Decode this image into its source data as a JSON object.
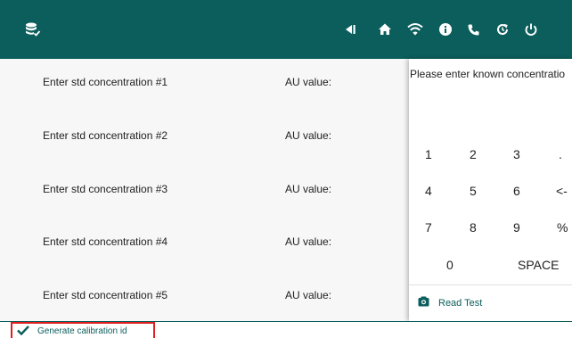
{
  "colors": {
    "header": "#0b5e5c",
    "accent": "#0b5e5c",
    "highlight": "#e02020"
  },
  "header": {
    "icons": [
      "database-check-icon",
      "step-back-icon",
      "home-icon",
      "wifi-icon",
      "info-icon",
      "phone-icon",
      "refresh-icon",
      "power-icon"
    ]
  },
  "rows": [
    {
      "label": "Enter std concentration #1",
      "au_label": "AU value:"
    },
    {
      "label": "Enter std concentration #2",
      "au_label": "AU value:"
    },
    {
      "label": "Enter std concentration #3",
      "au_label": "AU value:"
    },
    {
      "label": "Enter std concentration #4",
      "au_label": "AU value:"
    },
    {
      "label": "Enter std concentration #5",
      "au_label": "AU value:"
    }
  ],
  "keypad": {
    "prompt": "Please enter known concentratio",
    "keys": {
      "k1": "1",
      "k2": "2",
      "k3": "3",
      "kdot": ".",
      "k4": "4",
      "k5": "5",
      "k6": "6",
      "kback": "<-",
      "k7": "7",
      "k8": "8",
      "k9": "9",
      "kpct": "%",
      "k0": "0",
      "kspace": "SPACE"
    },
    "read_test_label": "Read Test"
  },
  "footer": {
    "generate_label": "Generate calibration id"
  }
}
